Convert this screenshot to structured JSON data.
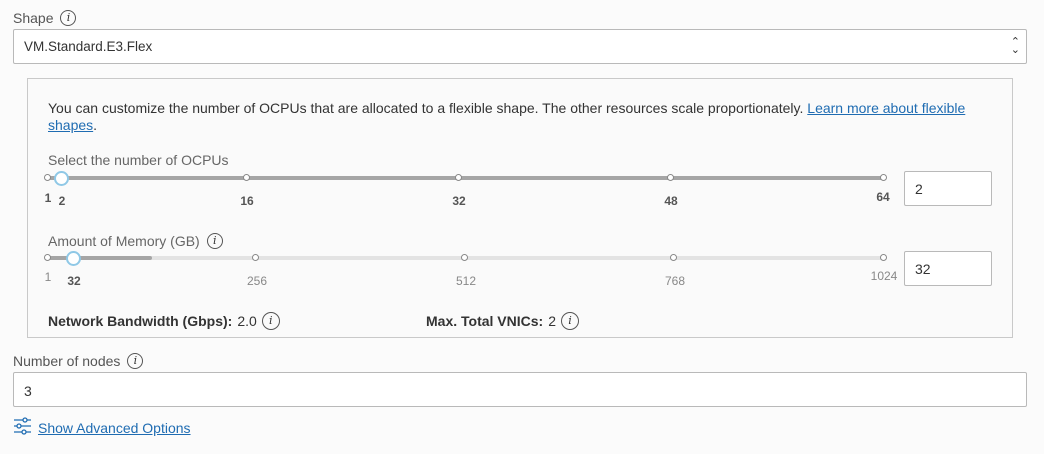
{
  "shape": {
    "label": "Shape",
    "selected": "VM.Standard.E3.Flex"
  },
  "flex": {
    "description": "You can customize the number of OCPUs that are allocated to a flexible shape. The other resources scale proportionately. ",
    "learn_more_link": "Learn more about flexible shapes",
    "learn_more_suffix": ".",
    "ocpu": {
      "label": "Select the number of OCPUs",
      "min": 1,
      "max": 64,
      "value": 2,
      "ticks": [
        "1",
        "2",
        "16",
        "32",
        "48",
        "64"
      ],
      "input_value": "2"
    },
    "memory": {
      "label": "Amount of Memory (GB)",
      "min": 1,
      "max": 1024,
      "value": 32,
      "ticks": [
        "1",
        "32",
        "256",
        "512",
        "768",
        "1024"
      ],
      "input_value": "32"
    },
    "bandwidth": {
      "label": "Network Bandwidth (Gbps):",
      "value": "2.0"
    },
    "vnics": {
      "label": "Max. Total VNICs:",
      "value": "2"
    }
  },
  "nodes": {
    "label": "Number of nodes",
    "value": "3"
  },
  "advanced": {
    "link": "Show Advanced Options"
  },
  "icons": {
    "info": "info-icon",
    "caret": "updown-caret-icon",
    "settings": "sliders-settings-icon"
  },
  "colors": {
    "link": "#1f6cb2",
    "thumb_border": "#8fc8e6"
  }
}
